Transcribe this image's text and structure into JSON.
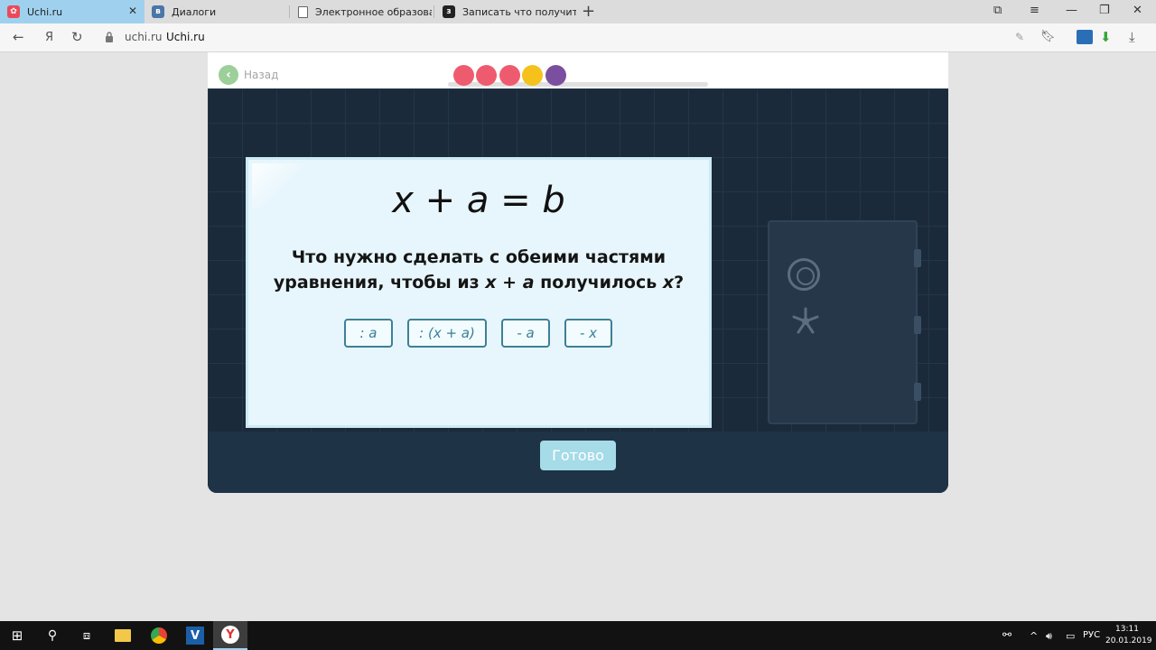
{
  "browser": {
    "tabs": [
      {
        "label": "Uchi.ru",
        "icon": "uchi-logo-icon",
        "active": true
      },
      {
        "label": "Диалоги",
        "icon": "vk-logo-icon",
        "active": false
      },
      {
        "label": "Электронное образовани",
        "icon": "page-icon",
        "active": false
      },
      {
        "label": "Записать что получится в",
        "icon": "bookmark-icon",
        "active": false
      }
    ],
    "address": {
      "domain": "uchi.ru",
      "title": "Uchi.ru"
    }
  },
  "app": {
    "back_label": "Назад",
    "progress_dots": [
      {
        "color": "#ef5b6e",
        "state": "error"
      },
      {
        "color": "#ef5b6e",
        "state": "error"
      },
      {
        "color": "#ef5b6e",
        "state": "error"
      },
      {
        "color": "#f5c21b",
        "state": "done"
      },
      {
        "color": "#7b4fa0",
        "state": "current"
      }
    ],
    "task": {
      "equation": "x + a = b",
      "question_part1": "Что нужно сделать с обеими частями уравнения, чтобы из ",
      "question_expr": "x + a",
      "question_part2": " получилось ",
      "question_var": "x",
      "question_end": "?",
      "options": [
        ": a",
        ": (x + a)",
        "- a",
        "- x"
      ]
    },
    "done_button": "Готово"
  },
  "taskbar": {
    "language": "РУС",
    "time": "13:11",
    "date": "20.01.2019"
  },
  "colors": {
    "accent_tab": "#9fd1ee",
    "option_border": "#3e8096",
    "done_button": "#a6dbe8"
  }
}
